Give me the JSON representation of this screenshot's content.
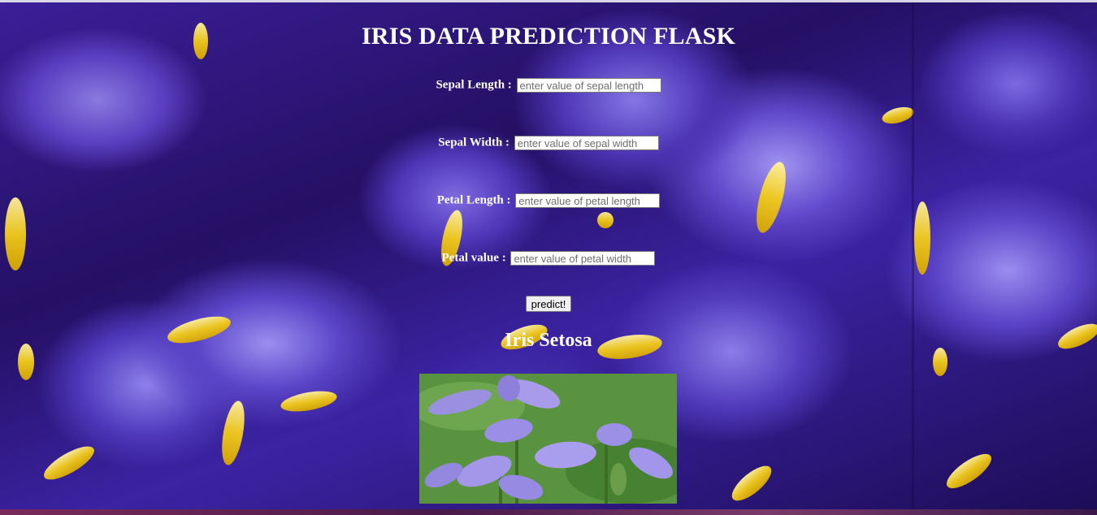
{
  "title": "IRIS DATA PREDICTION FLASK",
  "form": {
    "fields": [
      {
        "label": "Sepal Length :",
        "placeholder": "enter value of sepal length"
      },
      {
        "label": "Sepal Width :",
        "placeholder": "enter value of sepal width"
      },
      {
        "label": "Petal Length :",
        "placeholder": "enter value of petal length"
      },
      {
        "label": "Petal value :",
        "placeholder": "enter value of petal width"
      }
    ],
    "submit_label": "predict!"
  },
  "result": {
    "text": "Iris Setosa",
    "image": "iris-flower-photo"
  },
  "background": {
    "image": "iris-flowers-background"
  },
  "colors": {
    "heading_text": "#ffffff",
    "background_primary": "#3a1f98",
    "iris_yellow": "#f3cc1a"
  }
}
